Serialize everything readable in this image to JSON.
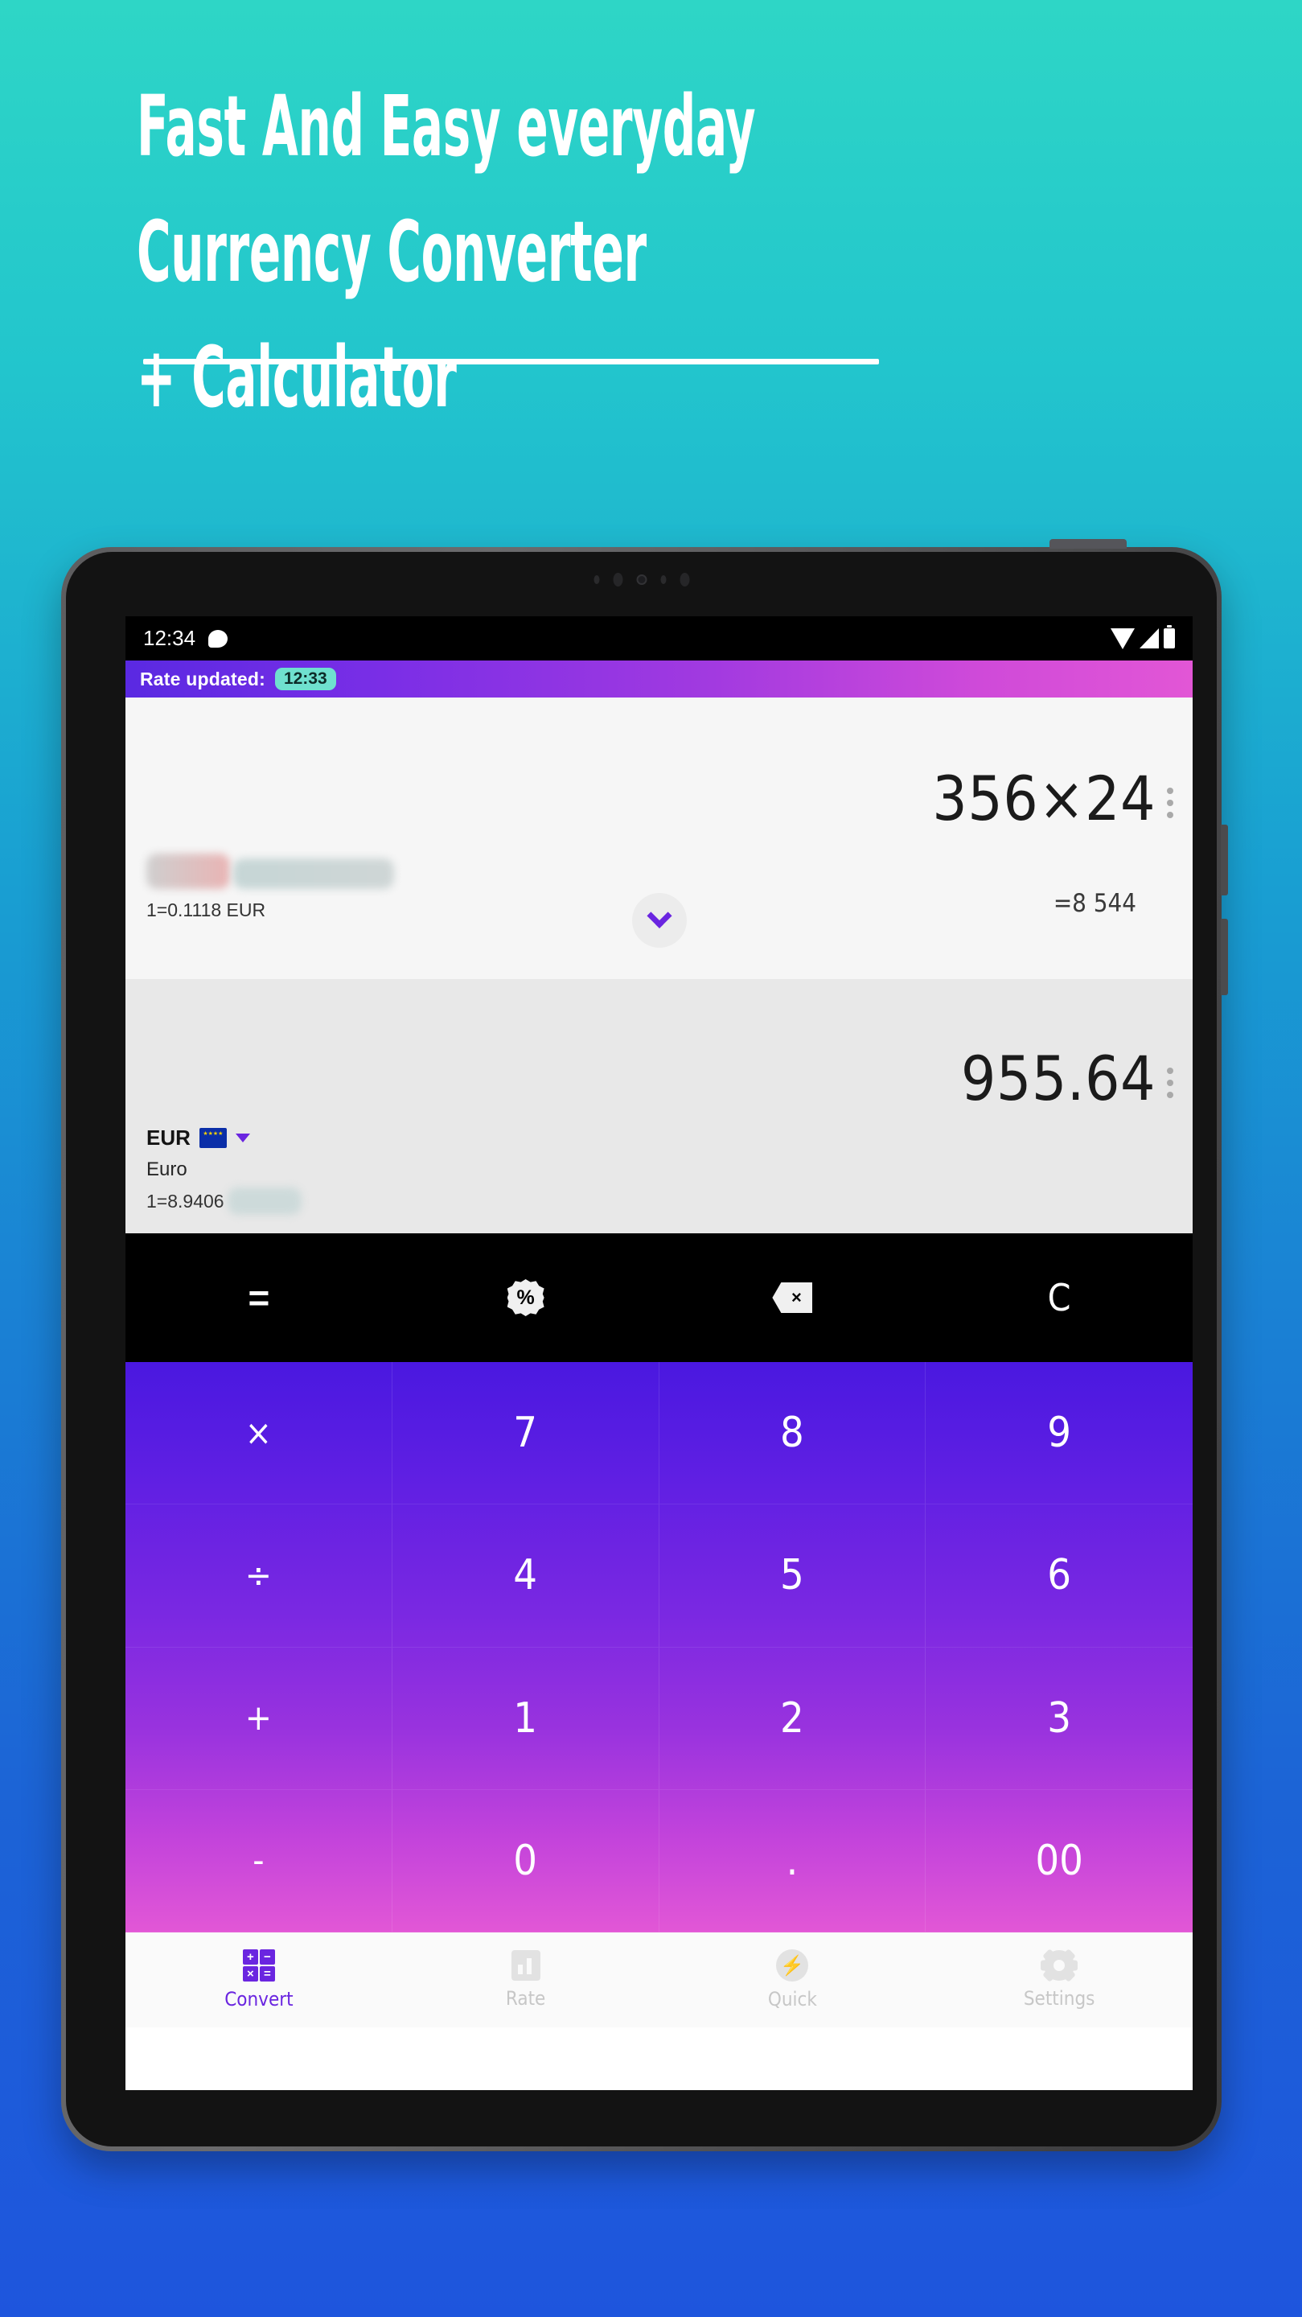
{
  "hero": {
    "line1": "Fast And Easy everyday",
    "line2": "Currency Converter",
    "line3": "+ Calculator"
  },
  "device": {
    "statusbar": {
      "time": "12:34",
      "message_icon": "message-icon",
      "wifi_icon": "wifi-icon",
      "signal_icon": "signal-icon",
      "battery_icon": "battery-icon"
    }
  },
  "appbar": {
    "label": "Rate updated:",
    "badge_time": "12:33",
    "gradient_from": "#5a29e2",
    "gradient_to": "#e256d6",
    "badge_color": "#6fe0cf"
  },
  "converter": {
    "rows": [
      {
        "code": "",
        "name": "",
        "rate_text": "1=0.1118 EUR",
        "amount": "356×24",
        "sub_result": "=8 544",
        "redacted_code": true,
        "redacted_name": true,
        "kebab_icon": "more-vertical-icon"
      },
      {
        "code": "EUR",
        "name": "Euro",
        "rate_text": "1=8.9406",
        "amount": "955.64",
        "sub_result": "",
        "flag_icon": "eu-flag-icon",
        "dropdown_icon": "caret-down-icon",
        "kebab_icon": "more-vertical-icon"
      }
    ],
    "expand_icon": "chevron-down-icon",
    "accent_color": "#6a25e0"
  },
  "function_bar": {
    "keys": [
      {
        "label": "=",
        "name": "equals-button",
        "style": "text"
      },
      {
        "label": "%",
        "name": "percent-button",
        "style": "badge"
      },
      {
        "label": "×",
        "name": "backspace-button",
        "style": "backspace"
      },
      {
        "label": "C",
        "name": "clear-button",
        "style": "text"
      }
    ]
  },
  "keypad": {
    "keys": [
      {
        "label": "×",
        "name": "key-multiply",
        "type": "op"
      },
      {
        "label": "7",
        "name": "key-7",
        "type": "digit"
      },
      {
        "label": "8",
        "name": "key-8",
        "type": "digit"
      },
      {
        "label": "9",
        "name": "key-9",
        "type": "digit"
      },
      {
        "label": "÷",
        "name": "key-divide",
        "type": "op"
      },
      {
        "label": "4",
        "name": "key-4",
        "type": "digit"
      },
      {
        "label": "5",
        "name": "key-5",
        "type": "digit"
      },
      {
        "label": "6",
        "name": "key-6",
        "type": "digit"
      },
      {
        "label": "+",
        "name": "key-plus",
        "type": "op"
      },
      {
        "label": "1",
        "name": "key-1",
        "type": "digit"
      },
      {
        "label": "2",
        "name": "key-2",
        "type": "digit"
      },
      {
        "label": "3",
        "name": "key-3",
        "type": "digit"
      },
      {
        "label": "-",
        "name": "key-minus",
        "type": "op"
      },
      {
        "label": "0",
        "name": "key-0",
        "type": "digit"
      },
      {
        "label": ".",
        "name": "key-decimal",
        "type": "digit"
      },
      {
        "label": "00",
        "name": "key-double-zero",
        "type": "digit"
      }
    ],
    "gradient_from": "#4a18e0",
    "gradient_to": "#e257d6"
  },
  "bottom_nav": {
    "items": [
      {
        "label": "Convert",
        "icon": "calculator-icon",
        "active": true
      },
      {
        "label": "Rate",
        "icon": "bar-chart-icon",
        "active": false
      },
      {
        "label": "Quick",
        "icon": "lightning-bolt-icon",
        "active": false
      },
      {
        "label": "Settings",
        "icon": "gear-icon",
        "active": false
      }
    ],
    "active_color": "#6a25e0",
    "inactive_color": "#c7c7c7"
  },
  "convert_icon_symbols": [
    "+",
    "−",
    "×",
    "="
  ]
}
